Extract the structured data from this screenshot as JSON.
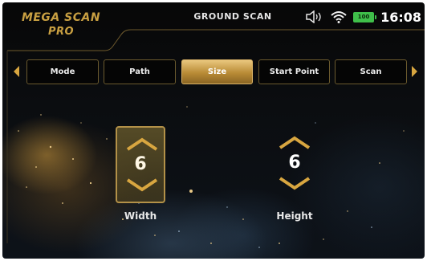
{
  "app": {
    "logo_line1": "MEGA SCAN",
    "logo_line2": "PRO",
    "title": "GROUND SCAN"
  },
  "status": {
    "volume_icon": "speaker-icon",
    "wifi_icon": "wifi-icon",
    "battery_label": "100",
    "time": "16:08"
  },
  "tabs": [
    {
      "label": "Mode"
    },
    {
      "label": "Path"
    },
    {
      "label": "Size"
    },
    {
      "label": "Start Point"
    },
    {
      "label": "Scan"
    }
  ],
  "active_tab": "Size",
  "size": {
    "width": {
      "label": "Width",
      "value": "6",
      "selected": true
    },
    "height": {
      "label": "Height",
      "value": "6",
      "selected": false
    }
  },
  "colors": {
    "accent_gold": "#c9a042",
    "tab_active": "#d9b266",
    "battery": "#3fbf4a"
  }
}
